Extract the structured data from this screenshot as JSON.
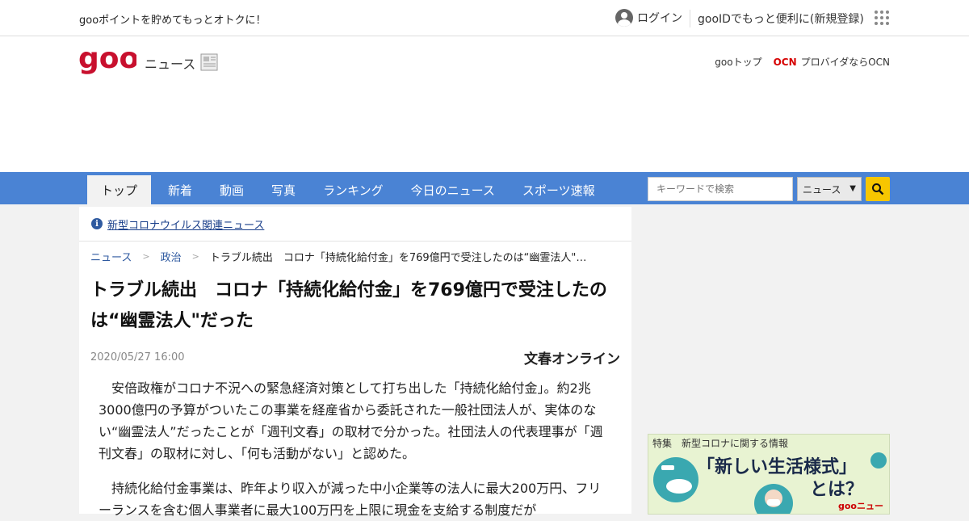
{
  "top_strip": {
    "promo": "gooポイントを貯めてもっとオトクに！",
    "login": "ログイン",
    "register": "gooIDでもっと便利に(新規登録)"
  },
  "header": {
    "logo_text": "goo",
    "news_label": "ニュース",
    "goo_top": "gooトップ",
    "ocn_mark": "OCN",
    "ocn_text": "プロバイダならOCN"
  },
  "nav": {
    "tabs": [
      {
        "label": "トップ",
        "active": true
      },
      {
        "label": "新着"
      },
      {
        "label": "動画"
      },
      {
        "label": "写真"
      },
      {
        "label": "ランキング"
      },
      {
        "label": "今日のニュース"
      },
      {
        "label": "スポーツ速報"
      }
    ],
    "search_placeholder": "キーワードで検索",
    "search_scope": "ニュース"
  },
  "article": {
    "covid_link": "新型コロナウイルス関連ニュース",
    "breadcrumb": [
      "ニュース",
      "政治",
      "トラブル続出　コロナ「持続化給付金」を769億円で受注したのは“幽霊法人\"…"
    ],
    "headline": "トラブル続出　コロナ「持続化給付金」を769億円で受注したのは“幽霊法人\"だった",
    "date": "2020/05/27 16:00",
    "source": "文春オンライン",
    "paragraphs": [
      "安倍政権がコロナ不況への緊急経済対策として打ち出した「持続化給付金」。約2兆3000億円の予算がついたこの事業を経産省から委託された一般社団法人が、実体のない“幽霊法人”だったことが「週刊文春」の取材で分かった。社団法人の代表理事が「週刊文春」の取材に対し、「何も活動がない」と認めた。",
      "持続化給付金事業は、昨年より収入が減った中小企業等の法人に最大200万円、フリーランスを含む個人事業者に最大100万円を上限に現金を支給する制度だが"
    ]
  },
  "sidebar": {
    "banner_tag": "特集　新型コロナに関する情報",
    "banner_title": "「新しい生活様式」",
    "banner_sub": "とは？",
    "banner_brand": "gooニュース"
  }
}
